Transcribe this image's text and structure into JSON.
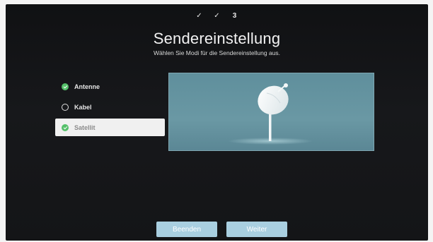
{
  "steps": [
    "✓",
    "✓",
    "3"
  ],
  "title": "Sendereinstellung",
  "subtitle": "Wählen Sie Modi für die Sendereinstellung aus.",
  "options": [
    {
      "label": "Antenne",
      "checked": true,
      "selected": false
    },
    {
      "label": "Kabel",
      "checked": false,
      "selected": false
    },
    {
      "label": "Satellit",
      "checked": true,
      "selected": true
    }
  ],
  "preview_icon": "satellite-dish-icon",
  "buttons": {
    "back": "Beenden",
    "next": "Weiter"
  },
  "colors": {
    "accent": "#a9cfe0",
    "check": "#55c06a",
    "preview_bg": "#6a98a4"
  }
}
